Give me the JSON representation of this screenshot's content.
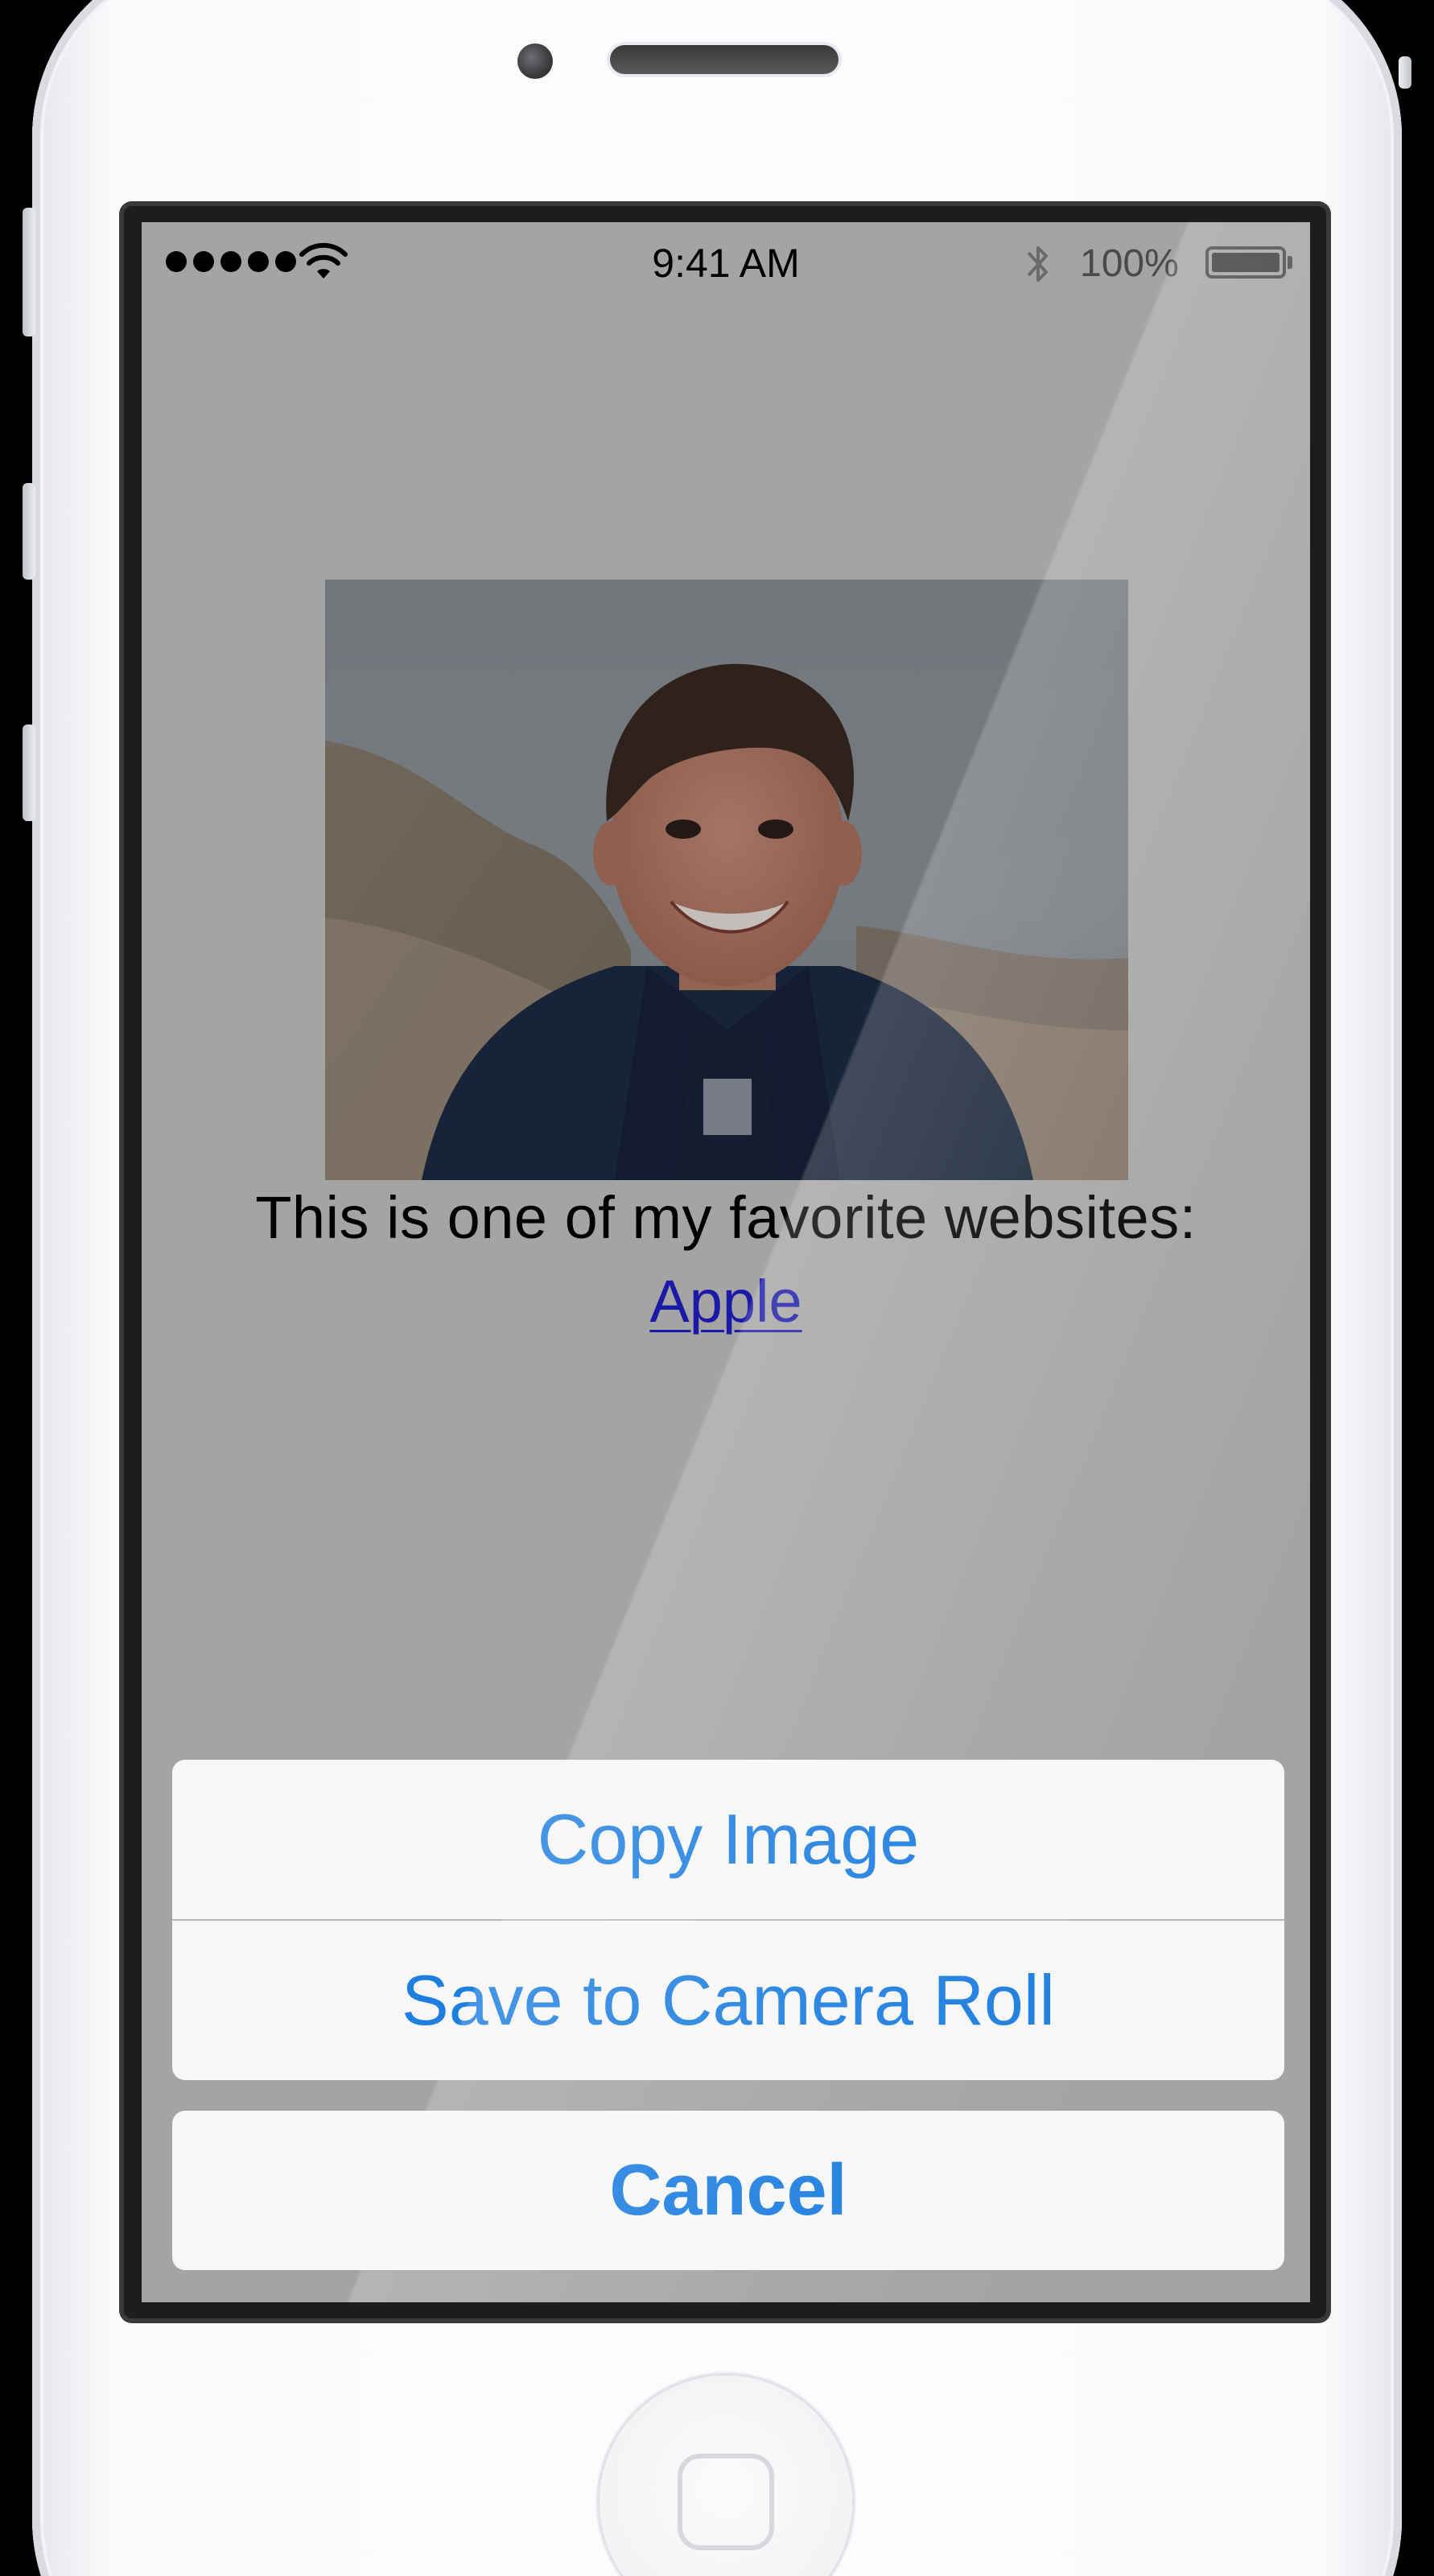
{
  "status_bar": {
    "time": "9:41 AM",
    "battery_percent": "100%",
    "signal_bars": 5,
    "icons": [
      "signal-dots-icon",
      "wifi-icon",
      "bluetooth-icon",
      "battery-icon"
    ]
  },
  "web_content": {
    "photo_alt": "Smiling boy photo",
    "caption": "This is one of my favorite websites:",
    "link_label": "Apple"
  },
  "action_sheet": {
    "copy_image_label": "Copy Image",
    "save_label": "Save to Camera Roll",
    "cancel_label": "Cancel"
  },
  "colors": {
    "action_blue": "#1f7fe0",
    "link_blue": "#1a1aa6",
    "dim_overlay": "#a4a4a4",
    "sheet_background": "#f7f7f8"
  }
}
